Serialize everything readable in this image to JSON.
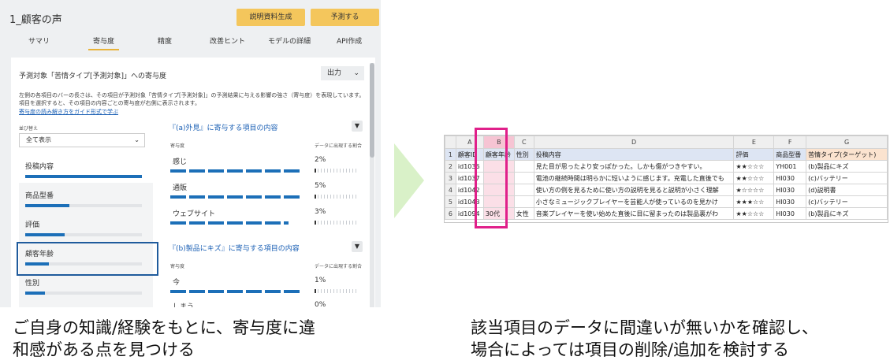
{
  "app": {
    "title": "1_顧客の声",
    "buttons": {
      "explain": "説明資料生成",
      "predict": "予測する"
    },
    "tabs": [
      "サマリ",
      "寄与度",
      "精度",
      "改善ヒント",
      "モデルの詳細",
      "API作成"
    ],
    "card": {
      "heading": "予測対象「苦情タイプ[予測対象]」への寄与度",
      "output_label": "出力",
      "description": "左側の各項目のバーの長さは、その項目が予測対象「苦情タイプ[予測対象]」の予測結果に与える影響の強さ（寄与度）を表現しています。項目を選択すると、その項目の内容ごとの寄与度が右側に表示されます。",
      "guide_link": "寄与度の読み解き方をガイド形式で学ぶ",
      "sort_label": "並び替え",
      "sort_value": "全て表示",
      "items": [
        {
          "label": "投稿内容",
          "level": 1.0
        },
        {
          "label": "商品型番",
          "level": 0.38
        },
        {
          "label": "評価",
          "level": 0.34
        },
        {
          "label": "顧客年齢",
          "level": 0.2
        },
        {
          "label": "性別",
          "level": 0.17
        }
      ],
      "sections": [
        {
          "title": "『(a)外見』に寄与する項目の内容",
          "col_contrib": "寄与度",
          "col_ratio": "データに出現する割合",
          "rows": [
            {
              "label": "感じ",
              "pct": "2%"
            },
            {
              "label": "通販",
              "pct": "5%"
            },
            {
              "label": "ウェブサイト",
              "pct": "3%"
            }
          ]
        },
        {
          "title": "『(b)製品にキズ』に寄与する項目の内容",
          "col_contrib": "寄与度",
          "col_ratio": "データに出現する割合",
          "rows": [
            {
              "label": "今",
              "pct": "1%"
            },
            {
              "label": "しまう",
              "pct": "0%"
            }
          ]
        }
      ]
    }
  },
  "sheet": {
    "columns": [
      "A",
      "B",
      "C",
      "D",
      "E",
      "F",
      "G"
    ],
    "row_numbers": [
      "1",
      "2",
      "3",
      "4",
      "5",
      "6"
    ],
    "header": [
      "顧客ID",
      "顧客年齢",
      "性別",
      "投稿内容",
      "評価",
      "商品型番",
      "苦情タイプ(ターゲット)"
    ],
    "rows": [
      [
        "id1036",
        "",
        "",
        "見た目が思ったより安っぽかった。しかも傷がつきやすい。",
        "★★☆☆☆",
        "YH001",
        "(b)製品にキズ"
      ],
      [
        "id1037",
        "",
        "",
        "電池の継続時間は明らかに短いように感じます。充電した直後でも",
        "★★☆☆☆",
        "HI030",
        "(c)バッテリー"
      ],
      [
        "id1042",
        "",
        "",
        "使い方の例を見るために使い方の説明を見ると説明が小さく理解",
        "★☆☆☆☆",
        "HI030",
        "(d)説明書"
      ],
      [
        "id1043",
        "",
        "",
        "小さなミュージックプレイヤーを芸能人が使っているのを見かけ",
        "★★★☆☆",
        "HI030",
        "(c)バッテリー"
      ],
      [
        "id1094",
        "30代",
        "女性",
        "音楽プレイヤーを使い始めた直後に目に留まったのは製品裏がわ",
        "★★☆☆☆",
        "HI030",
        "(b)製品にキズ"
      ]
    ]
  },
  "captions": {
    "left_line1": "ご自身の知識/経験をもとに、寄与度に違",
    "left_line2": "和感がある点を見つける",
    "right_line1": "該当項目のデータに間違いが無いかを確認し、",
    "right_line2": "場合によっては項目の削除/追加を検討する"
  },
  "colors": {
    "accent": "#f4c65c",
    "bar": "#1c6fb8",
    "highlight_pink": "#e0208a",
    "highlight_blue": "#1f5b9c",
    "arrow": "#d9f1c8"
  }
}
